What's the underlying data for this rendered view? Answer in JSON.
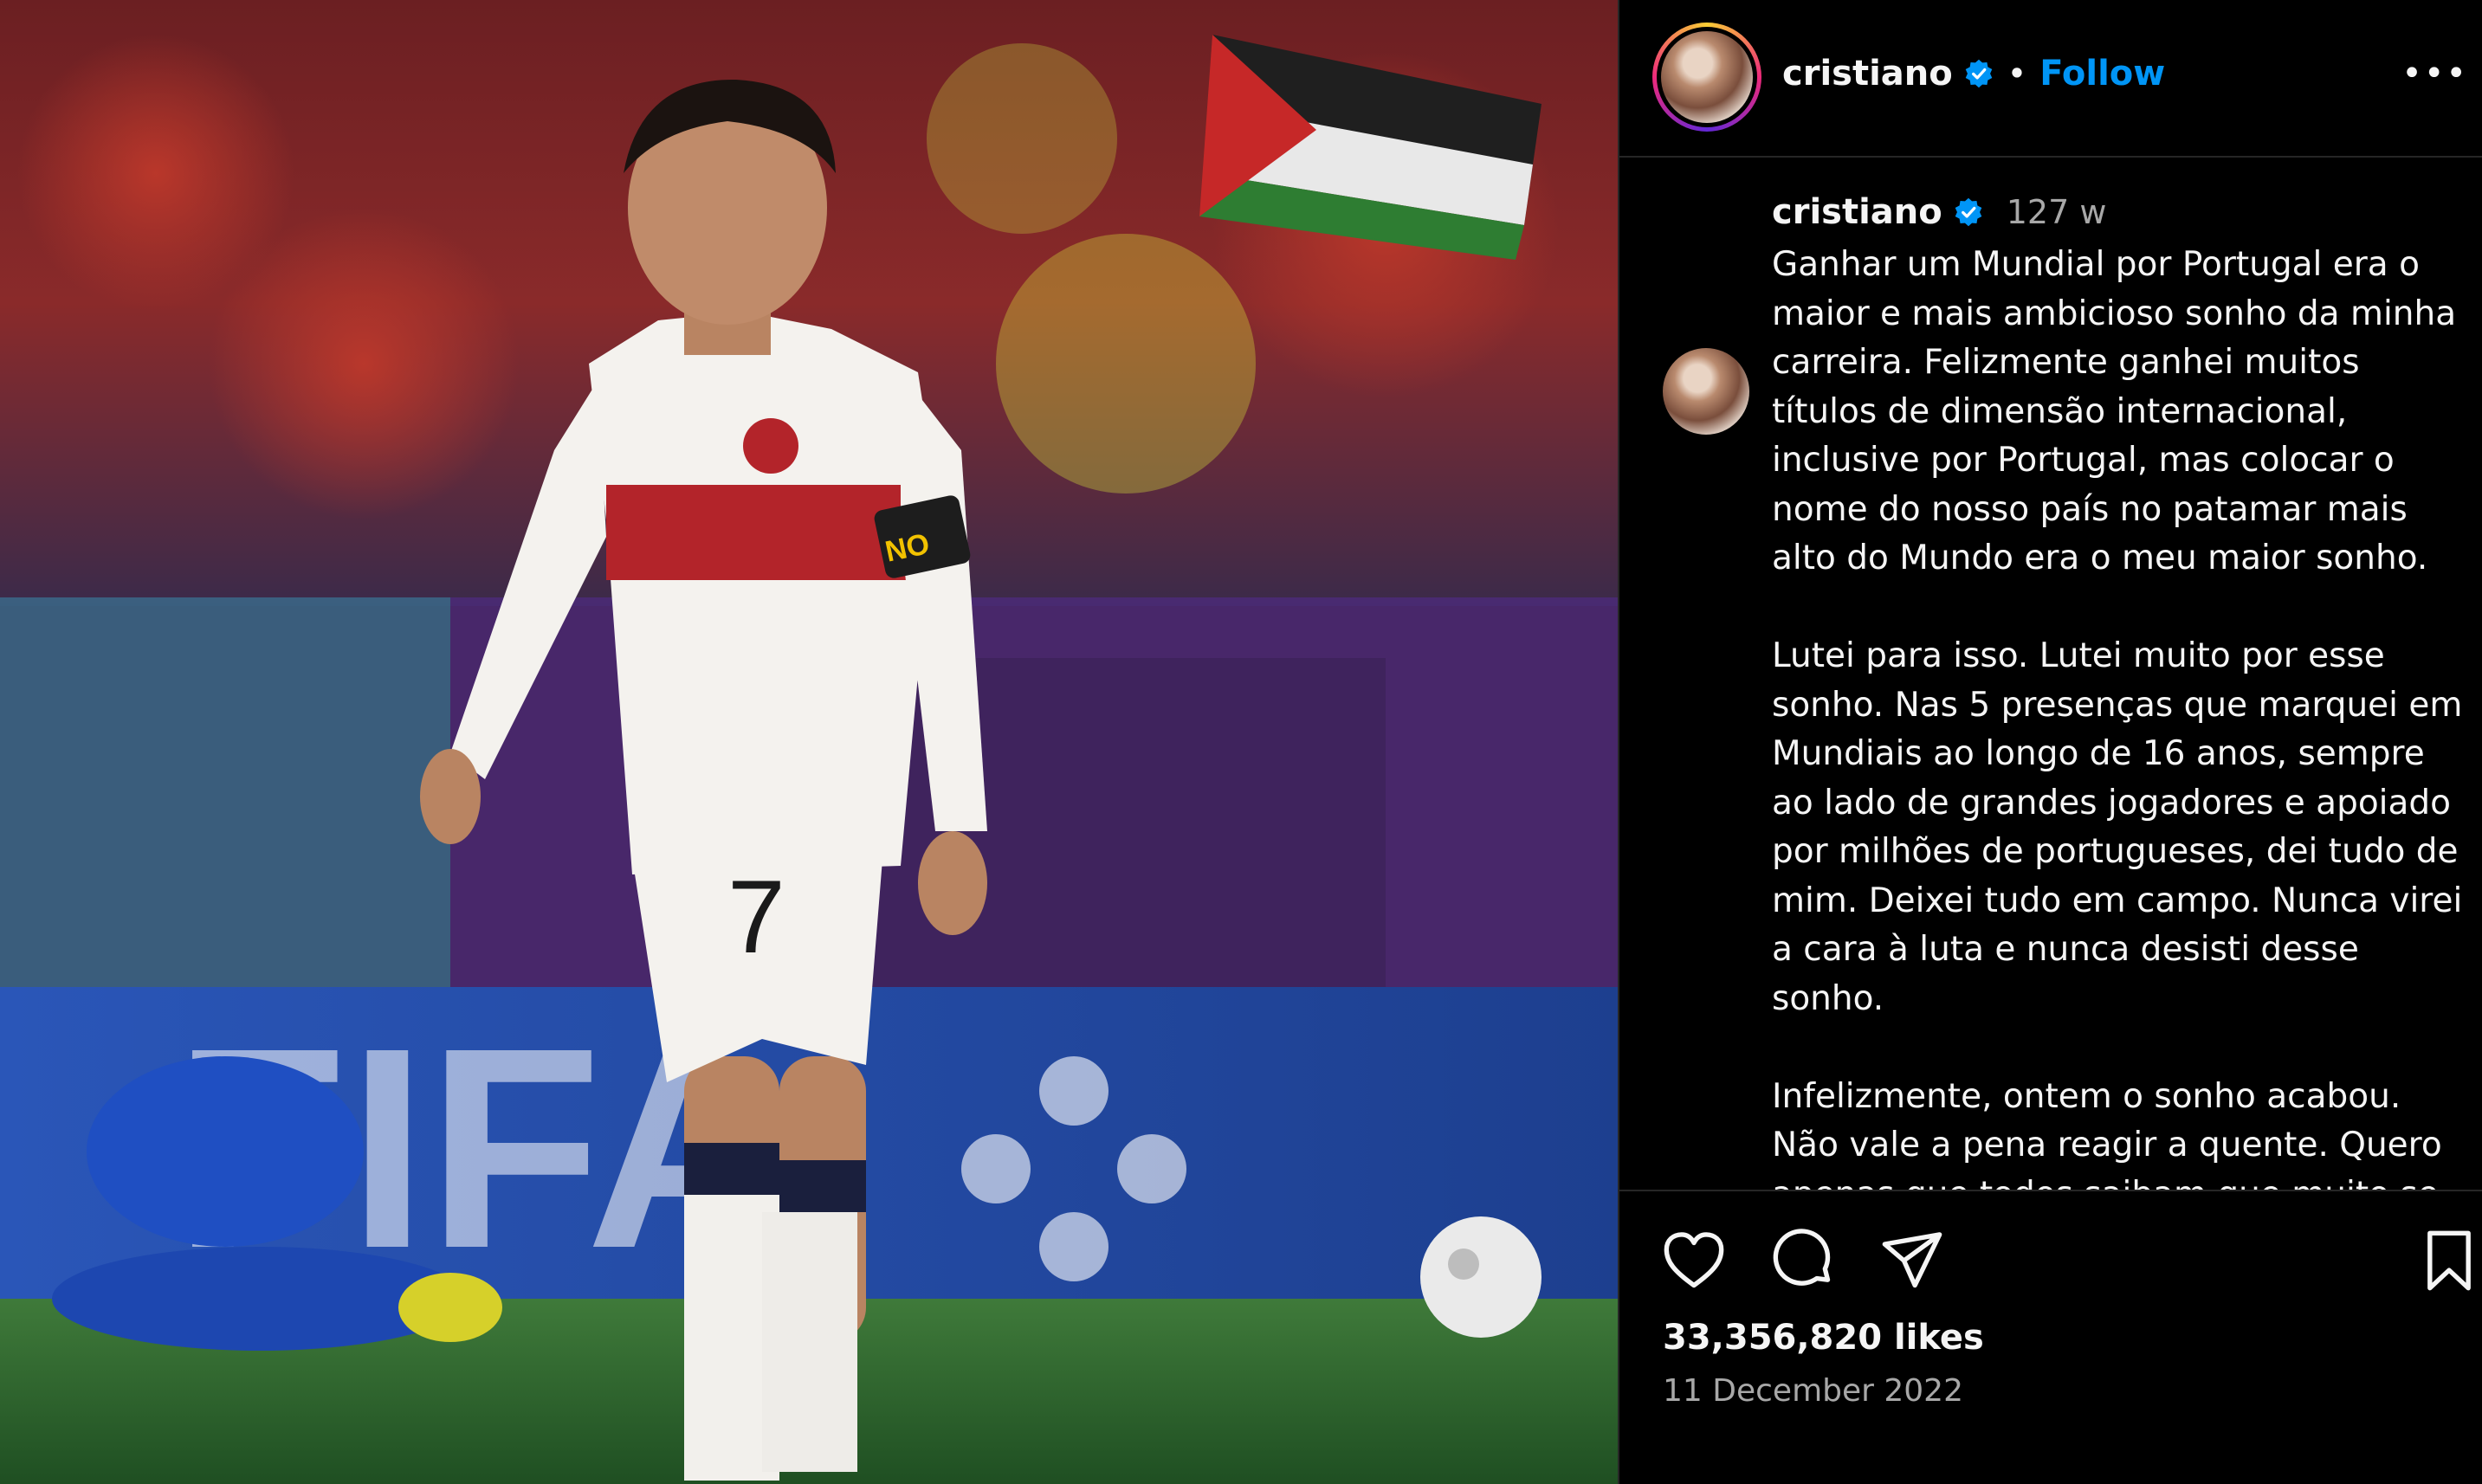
{
  "post": {
    "username": "cristiano",
    "follow_label": "Follow",
    "more_label": "•••",
    "separator": "•",
    "caption_time": "127 w",
    "caption": "Ganhar um Mundial por Portugal era o maior e mais ambicioso sonho da minha carreira. Felizmente ganhei muitos títulos de dimensão internacional, inclusive por Portugal, mas colocar o nome do nosso país no patamar mais alto do Mundo era o meu maior sonho.\n\nLutei para isso. Lutei muito por esse sonho. Nas 5 presenças que marquei em Mundiais ao longo de 16 anos, sempre ao lado de grandes jogadores e apoiado por milhões de portugueses, dei tudo de mim. Deixei tudo em campo. Nunca virei a cara à luta e nunca desisti desse sonho.\n\nInfelizmente, ontem o sonho acabou. Não vale a pena reagir a quente. Quero apenas que todos saibam que muito se",
    "likes": "33,356,820 likes",
    "date": "11 December 2022"
  },
  "photo": {
    "shirt_number": "7",
    "armband_text": "NO",
    "board_text": "FIFA"
  },
  "icons": {
    "verified": "verified-badge-icon",
    "like": "heart-icon",
    "comment": "comment-icon",
    "share": "send-icon",
    "save": "bookmark-icon"
  },
  "colors": {
    "follow": "#0095f6",
    "verified": "#0095f6",
    "background": "#000000",
    "secondary_text": "#a8a8a8"
  }
}
